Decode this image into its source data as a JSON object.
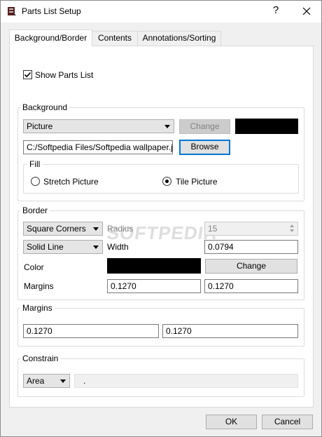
{
  "window": {
    "title": "Parts List Setup",
    "help_glyph": "?",
    "close_glyph": "×"
  },
  "tabs": [
    {
      "label": "Background/Border",
      "active": true
    },
    {
      "label": "Contents",
      "active": false
    },
    {
      "label": "Annotations/Sorting",
      "active": false
    }
  ],
  "show_parts_list": {
    "label": "Show Parts List",
    "checked": true
  },
  "background": {
    "title": "Background",
    "type_value": "Picture",
    "change_label": "Change",
    "color": "#000000",
    "path_value": "C:/Softpedia Files/Softpedia wallpaper.jpg",
    "browse_label": "Browse",
    "fill": {
      "title": "Fill",
      "options": [
        {
          "label": "Stretch Picture",
          "selected": false
        },
        {
          "label": "Tile Picture",
          "selected": true
        }
      ]
    }
  },
  "border": {
    "title": "Border",
    "corners_value": "Square Corners",
    "radius_label": "Radius",
    "radius_value": "15",
    "line_value": "Solid Line",
    "width_label": "Width",
    "width_value": "0.0794",
    "color_label": "Color",
    "color": "#000000",
    "change_label": "Change",
    "margins_label": "Margins",
    "margin_1": "0.1270",
    "margin_2": "0.1270"
  },
  "margins": {
    "title": "Margins",
    "value_1": "0.1270",
    "value_2": "0.1270"
  },
  "constrain": {
    "title": "Constrain",
    "mode_value": "Area",
    "field_value": "."
  },
  "watermark": "SOFTPEDIA",
  "footer": {
    "ok_label": "OK",
    "cancel_label": "Cancel"
  }
}
